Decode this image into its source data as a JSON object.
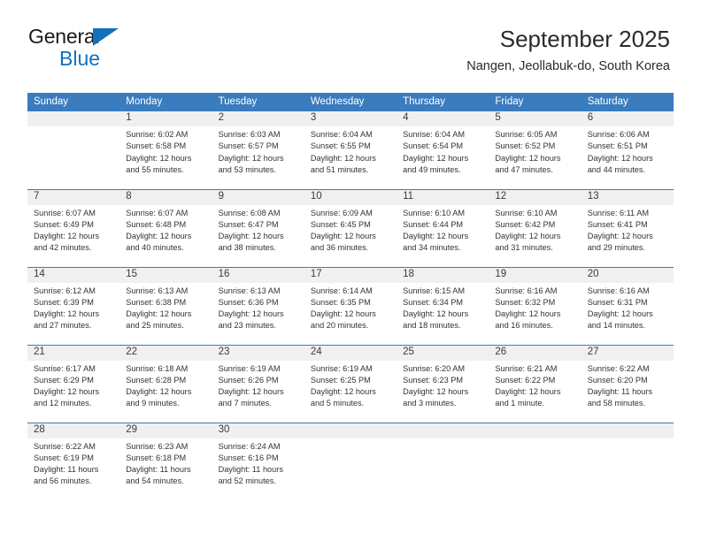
{
  "brand": {
    "word1": "General",
    "word2": "Blue",
    "triangle_color": "#1270bf"
  },
  "header": {
    "title": "September 2025",
    "subtitle": "Nangen, Jeollabuk-do, South Korea"
  },
  "theme": {
    "header_blue": "#3a7cbd",
    "band_gray": "#f0f0f0",
    "text": "#333333"
  },
  "weekday_headers": [
    "Sunday",
    "Monday",
    "Tuesday",
    "Wednesday",
    "Thursday",
    "Friday",
    "Saturday"
  ],
  "weeks": [
    [
      {
        "day": "",
        "sunrise": "",
        "sunset": "",
        "daylight1": "",
        "daylight2": ""
      },
      {
        "day": "1",
        "sunrise": "Sunrise: 6:02 AM",
        "sunset": "Sunset: 6:58 PM",
        "daylight1": "Daylight: 12 hours",
        "daylight2": "and 55 minutes."
      },
      {
        "day": "2",
        "sunrise": "Sunrise: 6:03 AM",
        "sunset": "Sunset: 6:57 PM",
        "daylight1": "Daylight: 12 hours",
        "daylight2": "and 53 minutes."
      },
      {
        "day": "3",
        "sunrise": "Sunrise: 6:04 AM",
        "sunset": "Sunset: 6:55 PM",
        "daylight1": "Daylight: 12 hours",
        "daylight2": "and 51 minutes."
      },
      {
        "day": "4",
        "sunrise": "Sunrise: 6:04 AM",
        "sunset": "Sunset: 6:54 PM",
        "daylight1": "Daylight: 12 hours",
        "daylight2": "and 49 minutes."
      },
      {
        "day": "5",
        "sunrise": "Sunrise: 6:05 AM",
        "sunset": "Sunset: 6:52 PM",
        "daylight1": "Daylight: 12 hours",
        "daylight2": "and 47 minutes."
      },
      {
        "day": "6",
        "sunrise": "Sunrise: 6:06 AM",
        "sunset": "Sunset: 6:51 PM",
        "daylight1": "Daylight: 12 hours",
        "daylight2": "and 44 minutes."
      }
    ],
    [
      {
        "day": "7",
        "sunrise": "Sunrise: 6:07 AM",
        "sunset": "Sunset: 6:49 PM",
        "daylight1": "Daylight: 12 hours",
        "daylight2": "and 42 minutes."
      },
      {
        "day": "8",
        "sunrise": "Sunrise: 6:07 AM",
        "sunset": "Sunset: 6:48 PM",
        "daylight1": "Daylight: 12 hours",
        "daylight2": "and 40 minutes."
      },
      {
        "day": "9",
        "sunrise": "Sunrise: 6:08 AM",
        "sunset": "Sunset: 6:47 PM",
        "daylight1": "Daylight: 12 hours",
        "daylight2": "and 38 minutes."
      },
      {
        "day": "10",
        "sunrise": "Sunrise: 6:09 AM",
        "sunset": "Sunset: 6:45 PM",
        "daylight1": "Daylight: 12 hours",
        "daylight2": "and 36 minutes."
      },
      {
        "day": "11",
        "sunrise": "Sunrise: 6:10 AM",
        "sunset": "Sunset: 6:44 PM",
        "daylight1": "Daylight: 12 hours",
        "daylight2": "and 34 minutes."
      },
      {
        "day": "12",
        "sunrise": "Sunrise: 6:10 AM",
        "sunset": "Sunset: 6:42 PM",
        "daylight1": "Daylight: 12 hours",
        "daylight2": "and 31 minutes."
      },
      {
        "day": "13",
        "sunrise": "Sunrise: 6:11 AM",
        "sunset": "Sunset: 6:41 PM",
        "daylight1": "Daylight: 12 hours",
        "daylight2": "and 29 minutes."
      }
    ],
    [
      {
        "day": "14",
        "sunrise": "Sunrise: 6:12 AM",
        "sunset": "Sunset: 6:39 PM",
        "daylight1": "Daylight: 12 hours",
        "daylight2": "and 27 minutes."
      },
      {
        "day": "15",
        "sunrise": "Sunrise: 6:13 AM",
        "sunset": "Sunset: 6:38 PM",
        "daylight1": "Daylight: 12 hours",
        "daylight2": "and 25 minutes."
      },
      {
        "day": "16",
        "sunrise": "Sunrise: 6:13 AM",
        "sunset": "Sunset: 6:36 PM",
        "daylight1": "Daylight: 12 hours",
        "daylight2": "and 23 minutes."
      },
      {
        "day": "17",
        "sunrise": "Sunrise: 6:14 AM",
        "sunset": "Sunset: 6:35 PM",
        "daylight1": "Daylight: 12 hours",
        "daylight2": "and 20 minutes."
      },
      {
        "day": "18",
        "sunrise": "Sunrise: 6:15 AM",
        "sunset": "Sunset: 6:34 PM",
        "daylight1": "Daylight: 12 hours",
        "daylight2": "and 18 minutes."
      },
      {
        "day": "19",
        "sunrise": "Sunrise: 6:16 AM",
        "sunset": "Sunset: 6:32 PM",
        "daylight1": "Daylight: 12 hours",
        "daylight2": "and 16 minutes."
      },
      {
        "day": "20",
        "sunrise": "Sunrise: 6:16 AM",
        "sunset": "Sunset: 6:31 PM",
        "daylight1": "Daylight: 12 hours",
        "daylight2": "and 14 minutes."
      }
    ],
    [
      {
        "day": "21",
        "sunrise": "Sunrise: 6:17 AM",
        "sunset": "Sunset: 6:29 PM",
        "daylight1": "Daylight: 12 hours",
        "daylight2": "and 12 minutes."
      },
      {
        "day": "22",
        "sunrise": "Sunrise: 6:18 AM",
        "sunset": "Sunset: 6:28 PM",
        "daylight1": "Daylight: 12 hours",
        "daylight2": "and 9 minutes."
      },
      {
        "day": "23",
        "sunrise": "Sunrise: 6:19 AM",
        "sunset": "Sunset: 6:26 PM",
        "daylight1": "Daylight: 12 hours",
        "daylight2": "and 7 minutes."
      },
      {
        "day": "24",
        "sunrise": "Sunrise: 6:19 AM",
        "sunset": "Sunset: 6:25 PM",
        "daylight1": "Daylight: 12 hours",
        "daylight2": "and 5 minutes."
      },
      {
        "day": "25",
        "sunrise": "Sunrise: 6:20 AM",
        "sunset": "Sunset: 6:23 PM",
        "daylight1": "Daylight: 12 hours",
        "daylight2": "and 3 minutes."
      },
      {
        "day": "26",
        "sunrise": "Sunrise: 6:21 AM",
        "sunset": "Sunset: 6:22 PM",
        "daylight1": "Daylight: 12 hours",
        "daylight2": "and 1 minute."
      },
      {
        "day": "27",
        "sunrise": "Sunrise: 6:22 AM",
        "sunset": "Sunset: 6:20 PM",
        "daylight1": "Daylight: 11 hours",
        "daylight2": "and 58 minutes."
      }
    ],
    [
      {
        "day": "28",
        "sunrise": "Sunrise: 6:22 AM",
        "sunset": "Sunset: 6:19 PM",
        "daylight1": "Daylight: 11 hours",
        "daylight2": "and 56 minutes."
      },
      {
        "day": "29",
        "sunrise": "Sunrise: 6:23 AM",
        "sunset": "Sunset: 6:18 PM",
        "daylight1": "Daylight: 11 hours",
        "daylight2": "and 54 minutes."
      },
      {
        "day": "30",
        "sunrise": "Sunrise: 6:24 AM",
        "sunset": "Sunset: 6:16 PM",
        "daylight1": "Daylight: 11 hours",
        "daylight2": "and 52 minutes."
      },
      {
        "day": "",
        "sunrise": "",
        "sunset": "",
        "daylight1": "",
        "daylight2": ""
      },
      {
        "day": "",
        "sunrise": "",
        "sunset": "",
        "daylight1": "",
        "daylight2": ""
      },
      {
        "day": "",
        "sunrise": "",
        "sunset": "",
        "daylight1": "",
        "daylight2": ""
      },
      {
        "day": "",
        "sunrise": "",
        "sunset": "",
        "daylight1": "",
        "daylight2": ""
      }
    ]
  ]
}
